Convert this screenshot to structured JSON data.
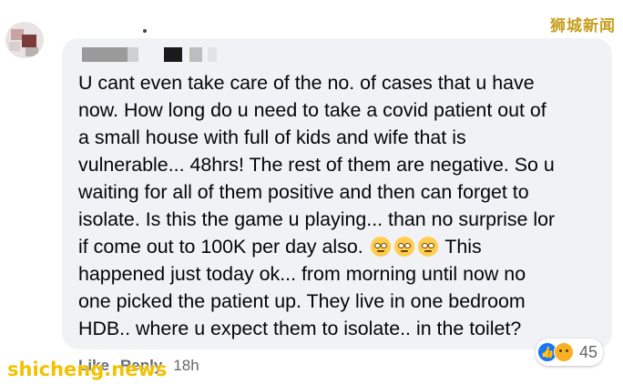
{
  "watermark_top": "狮城新闻",
  "comment": {
    "line1": "U cant even take care of the no. of cases that u have",
    "line2": "now. How long do u need to take a covid patient out of",
    "line3": "a small house with full of kids and wife that is",
    "line4": "vulnerable... 48hrs! The rest of them are negative. So u",
    "line5": "waiting for all of them positive and then can forget to",
    "line6": "isolate. Is this the game u playing... than no surprise lor",
    "line7_pre": "if come out to 100K per day also.",
    "line7_post": "This",
    "line8": "happened just today ok... from morning until now no",
    "line9": "one picked the patient up. They live in one bedroom",
    "line10": "HDB.. where u expect them to isolate.. in the toilet?"
  },
  "emojis": [
    "face-with-rolling-eyes-icon",
    "face-with-rolling-eyes-icon",
    "face-with-rolling-eyes-icon"
  ],
  "actions": {
    "like": "Like",
    "reply": "Reply",
    "time": "18h"
  },
  "reactions": {
    "icons": [
      "like-icon",
      "sad-icon"
    ],
    "count": "45"
  },
  "watermark_bottom": "shicheng.news",
  "colors": {
    "bubble": "#f0f2f5",
    "text": "#050505",
    "meta": "#65676b",
    "like_blue": "#1877f2",
    "watermark": "#f2c200"
  }
}
